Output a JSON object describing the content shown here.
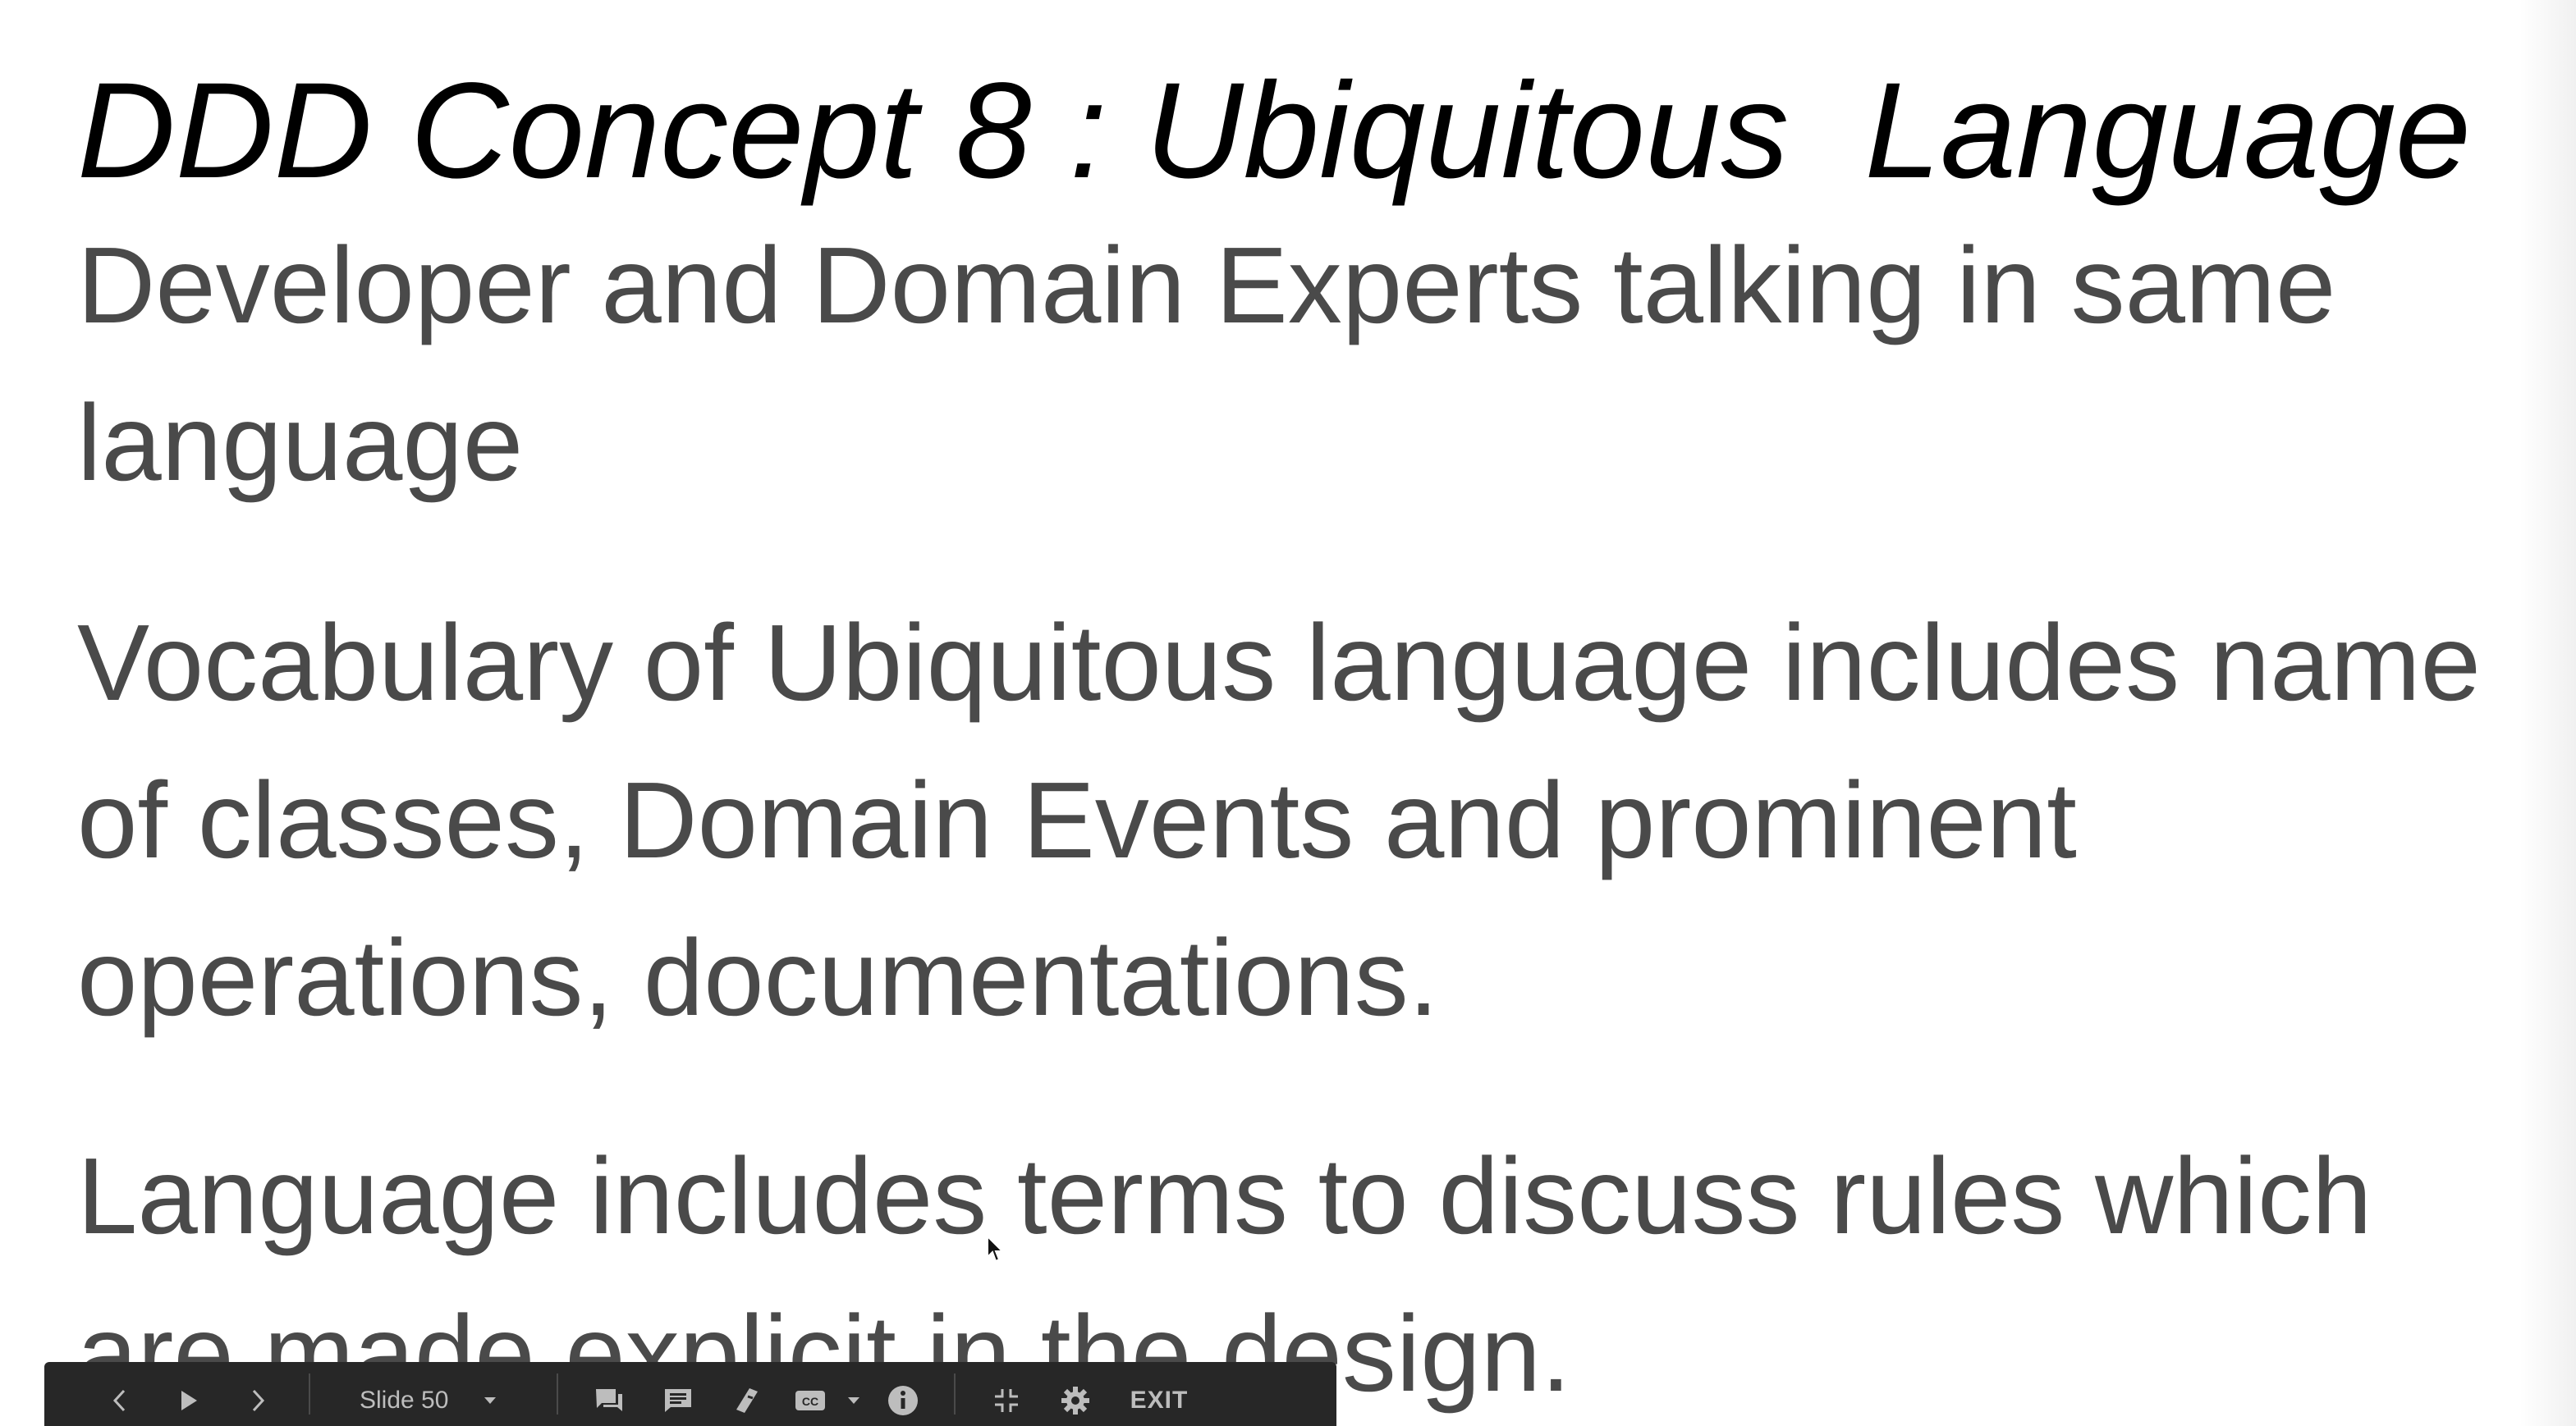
{
  "slide": {
    "title": "DDD Concept 8 : Ubiquitous  Language",
    "paragraphs": [
      "Developer and Domain Experts talking in same language",
      "Vocabulary of Ubiquitous language includes name of classes, Domain Events and prominent operations, documentations.",
      "Language includes terms to discuss rules which are made explicit in the design."
    ]
  },
  "toolbar": {
    "prev_icon": "chevron-left-icon",
    "play_icon": "play-icon",
    "next_icon": "chevron-right-icon",
    "slide_label": "Slide 50",
    "slide_dropdown_icon": "caret-down-icon",
    "comments_icon": "comments-icon",
    "notes_icon": "speaker-notes-icon",
    "laser_icon": "laser-pointer-icon",
    "captions_icon": "closed-captions-icon",
    "captions_dropdown_icon": "caret-down-icon",
    "info_icon": "info-icon",
    "exit_fullscreen_icon": "exit-fullscreen-icon",
    "settings_icon": "gear-icon",
    "exit_label": "EXIT"
  },
  "colors": {
    "title": "#000000",
    "body_text": "#4a4a4a",
    "toolbar_bg": "#272727",
    "toolbar_icon": "#bdbdbd"
  }
}
